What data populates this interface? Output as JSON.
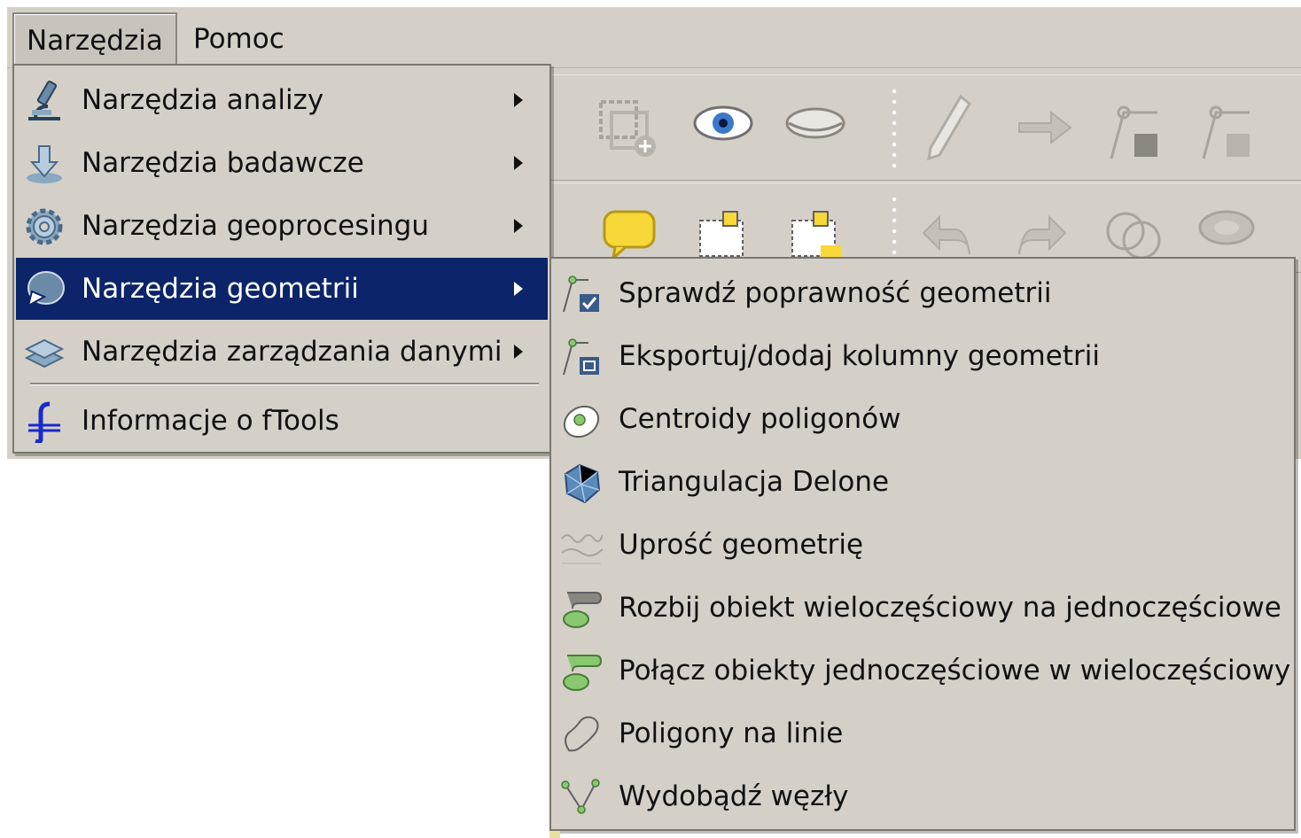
{
  "menubar": {
    "items": [
      {
        "label": "Narzędzia",
        "active": true
      },
      {
        "label": "Pomoc",
        "active": false
      }
    ]
  },
  "main_menu": {
    "items": [
      {
        "label": "Narzędzia analizy",
        "icon": "microscope-icon",
        "has_submenu": true
      },
      {
        "label": "Narzędzia badawcze",
        "icon": "download-arrow-icon",
        "has_submenu": true
      },
      {
        "label": "Narzędzia geoprocesingu",
        "icon": "gear-icon",
        "has_submenu": true
      },
      {
        "label": "Narzędzia geometrii",
        "icon": "geometry-icon",
        "has_submenu": true,
        "highlighted": true
      },
      {
        "label": "Narzędzia zarządzania danymi",
        "icon": "layers-icon",
        "has_submenu": true
      },
      {
        "label": "Informacje o fTools",
        "icon": "ftools-icon",
        "has_submenu": false
      }
    ]
  },
  "sub_menu": {
    "items": [
      {
        "label": "Sprawdź poprawność geometrii",
        "icon": "check-geometry-icon"
      },
      {
        "label": "Eksportuj/dodaj kolumny geometrii",
        "icon": "export-columns-icon"
      },
      {
        "label": "Centroidy poligonów",
        "icon": "centroid-icon"
      },
      {
        "label": "Triangulacja Delone",
        "icon": "triangulation-icon"
      },
      {
        "label": "Uprość geometrię",
        "icon": "simplify-icon"
      },
      {
        "label": "Rozbij obiekt wieloczęściowy na jednoczęściowe",
        "icon": "multi-to-single-icon"
      },
      {
        "label": "Połącz obiekty jednoczęściowe w wieloczęściowy",
        "icon": "single-to-multi-icon"
      },
      {
        "label": "Poligony na linie",
        "icon": "polygon-to-line-icon"
      },
      {
        "label": "Wydobądź węzły",
        "icon": "extract-nodes-icon"
      }
    ]
  },
  "colors": {
    "menu_bg": "#d4d0c8",
    "highlight_bg": "#0b246a",
    "highlight_text": "#ffffff"
  }
}
